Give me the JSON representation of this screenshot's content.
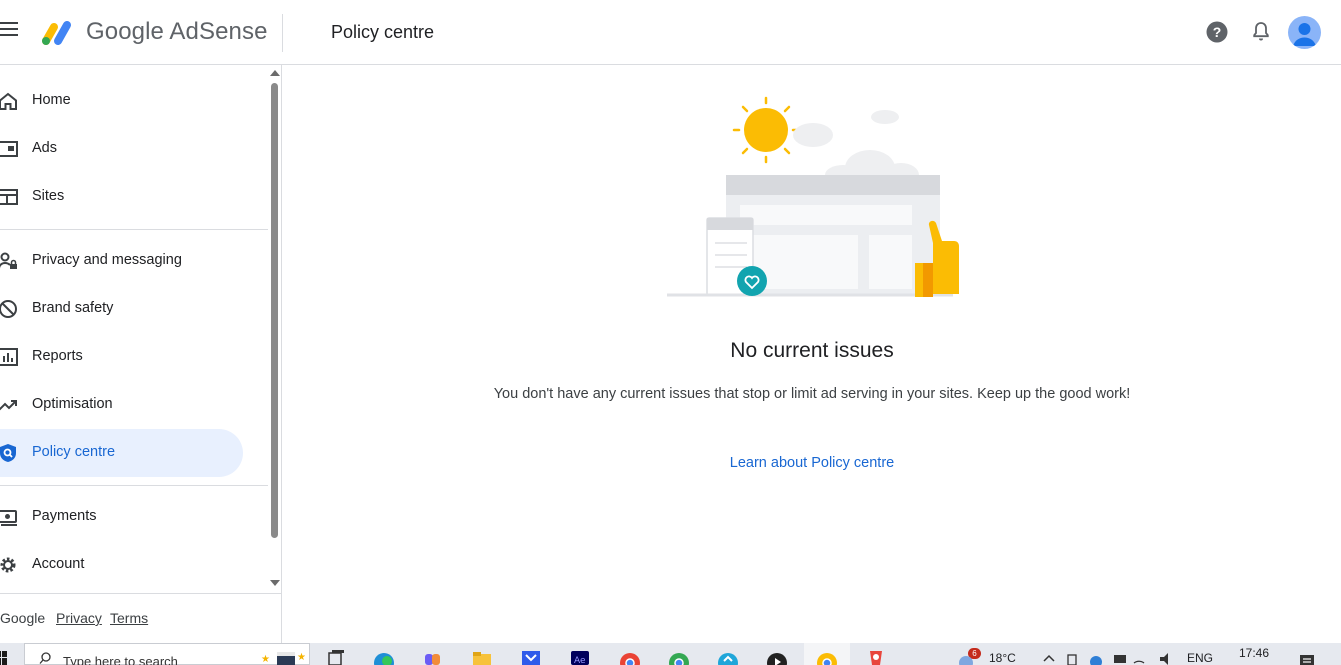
{
  "header": {
    "brand": "Google AdSense",
    "page_title": "Policy centre",
    "icons": [
      "menu-icon",
      "help-icon",
      "notifications-icon",
      "account-avatar"
    ]
  },
  "sidebar": {
    "items": [
      {
        "label": "Home",
        "icon": "home-icon"
      },
      {
        "label": "Ads",
        "icon": "ads-icon"
      },
      {
        "label": "Sites",
        "icon": "sites-icon"
      },
      {
        "label": "Privacy and messaging",
        "icon": "privacy-icon"
      },
      {
        "label": "Brand safety",
        "icon": "block-icon"
      },
      {
        "label": "Reports",
        "icon": "bar-chart-icon"
      },
      {
        "label": "Optimisation",
        "icon": "trending-icon"
      },
      {
        "label": "Policy centre",
        "icon": "shield-icon",
        "active": true
      },
      {
        "label": "Payments",
        "icon": "payments-icon"
      },
      {
        "label": "Account",
        "icon": "gear-icon"
      }
    ],
    "footer": {
      "google": "Google",
      "privacy": "Privacy",
      "terms": "Terms"
    }
  },
  "main": {
    "title": "No current issues",
    "description": "You don't have any current issues that stop or limit ad serving in your sites. Keep up the good work!",
    "link": "Learn about Policy centre"
  },
  "taskbar": {
    "search_placeholder": "Type here to search",
    "notification_count": "6",
    "temperature": "18°C",
    "language": "ENG",
    "time": "17:46"
  },
  "colors": {
    "accent": "#1967d2",
    "active_bg": "#e8f0fe",
    "divider": "#dadce0"
  }
}
